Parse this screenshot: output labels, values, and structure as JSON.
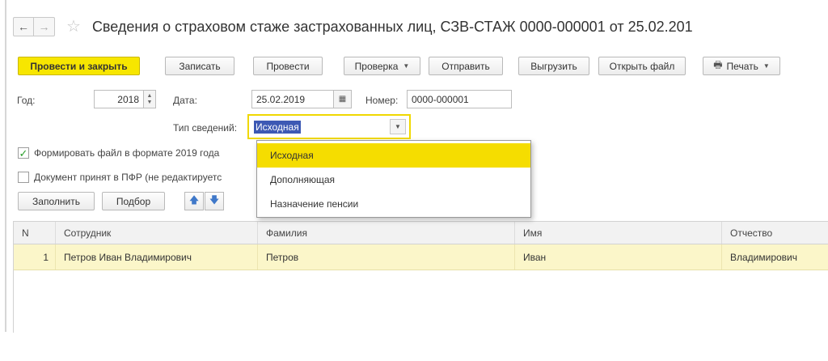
{
  "title": "Сведения о страховом стаже застрахованных лиц, СЗВ-СТАЖ 0000-000001 от 25.02.201",
  "nav": {
    "back": "←",
    "forward": "→",
    "favorite": "☆"
  },
  "toolbar": {
    "post_close": "Провести и закрыть",
    "save": "Записать",
    "post": "Провести",
    "check": "Проверка",
    "send": "Отправить",
    "export": "Выгрузить",
    "open_file": "Открыть файл",
    "print": "Печать"
  },
  "form": {
    "year_label": "Год:",
    "year_value": "2018",
    "date_label": "Дата:",
    "date_value": "25.02.2019",
    "number_label": "Номер:",
    "number_value": "0000-000001",
    "type_label": "Тип сведений:",
    "type_value": "Исходная",
    "checkbox_2019_label": "Формировать файл в формате 2019 года",
    "checkbox_2019_checked": true,
    "checkbox_pfr_label": "Документ принят в ПФР (не редактируетс",
    "checkbox_pfr_checked": false
  },
  "table_toolbar": {
    "fill": "Заполнить",
    "select": "Подбор"
  },
  "table": {
    "headers": [
      "N",
      "Сотрудник",
      "Фамилия",
      "Имя",
      "Отчество"
    ],
    "rows": [
      [
        "1",
        "Петров Иван Владимирович",
        "Петров",
        "Иван",
        "Владимирович"
      ]
    ]
  },
  "dropdown": {
    "options": [
      "Исходная",
      "Дополняющая",
      "Назначение пенсии"
    ],
    "selected_index": 0
  },
  "colors": {
    "accent_yellow": "#f7e600",
    "selection_blue": "#3d59b4",
    "row_highlight": "#fbf6c9"
  }
}
